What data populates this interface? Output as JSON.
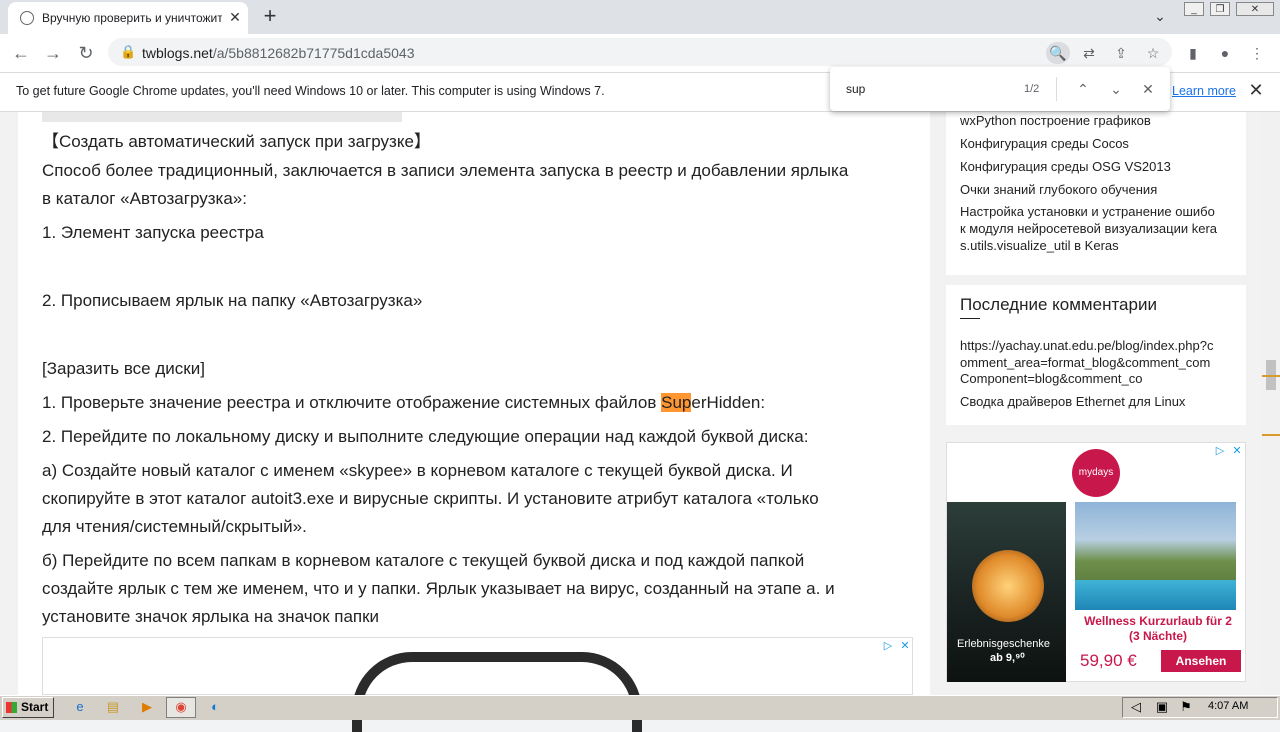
{
  "browser": {
    "tab_title": "Вручную проверить и уничтожить",
    "tab_close": "✕",
    "new_tab": "+",
    "url_host": "twblogs.net",
    "url_path": "/a/5b8812682b71775d1cda5043",
    "win_min": "_",
    "win_max": "❐",
    "win_close": "✕"
  },
  "infobar": {
    "text": "To get future Google Chrome updates, you'll need Windows 10 or later. This computer is using Windows 7.",
    "learn_more": "Learn more",
    "close": "✕"
  },
  "find": {
    "query": "sup",
    "count": "1/2"
  },
  "article": {
    "lines": [
      "【Создать автоматический запуск при загрузке】",
      "Способ более традиционный, заключается в записи элемента запуска в реестр и добавлении ярлыка",
      "в каталог «Автозагрузка»:",
      "1. Элемент запуска реестра",
      "2. Прописываем ярлык на папку «Автозагрузка»",
      "[Заразить все диски]",
      "2. Перейдите по локальному диску и выполните следующие операции над каждой буквой диска:",
      "а) Создайте новый каталог с именем «skypee» в корневом каталоге с текущей буквой диска. И",
      "скопируйте в этот каталог autoit3.exe и вирусные скрипты. И установите атрибут каталога «только",
      "для чтения/системный/скрытый».",
      "б) Перейдите по всем папкам в корневом каталоге с текущей буквой диска и под каждой папкой",
      "создайте ярлык с тем же именем, что и у папки. Ярлык указывает на вирус, созданный на этапе а. и",
      "установите значок ярлыка на значок папки"
    ],
    "registry_line_pre": "1. Проверьте значение реестра и отключите отображение системных файлов ",
    "registry_line_match": "Sup",
    "registry_line_post": "erHidden:"
  },
  "sidebar": {
    "links": [
      "wxPython построение графиков",
      "Конфигурация среды Cocos",
      "Конфигурация среды OSG VS2013",
      "Очки знаний глубокого обучения",
      "Настройка установки и устранение ошибо",
      "к модуля нейросетевой визуализации kera",
      "s.utils.visualize_util в Keras"
    ],
    "comments_title": "Последние комментарии",
    "comments": [
      "https://yachay.unat.edu.pe/blog/index.php?c",
      "omment_area=format_blog&comment_com",
      "Component=blog&comment_co",
      "Сводка драйверов Ethernet для Linux"
    ]
  },
  "side_ad": {
    "brand": "mydays",
    "caption1": "Erlebnisgeschenke",
    "caption2": "ab 9,⁹⁰",
    "headline1": "Wellness Kurzurlaub für 2",
    "headline2": "(3 Nächte)",
    "price": "59,90 €",
    "cta": "Ansehen"
  },
  "taskbar": {
    "start": "Start",
    "time": "4:07 AM"
  },
  "icons": {
    "back": "←",
    "forward": "→",
    "reload": "↻",
    "lock": "🔒",
    "star": "☆",
    "share": "⇪",
    "translate": "⇄",
    "zoom": "🔍",
    "sidepanel": "▮",
    "profile": "●",
    "menu": "⋮",
    "find_up": "⌃",
    "find_down": "⌄",
    "find_close": "✕",
    "adchoices": "▷",
    "ad_close": "✕"
  }
}
